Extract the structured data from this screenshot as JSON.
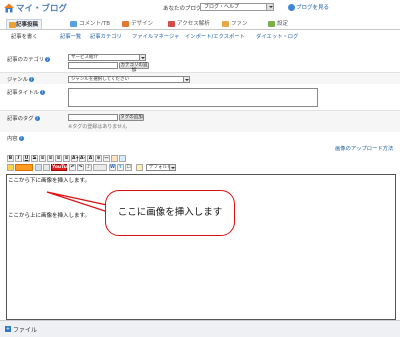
{
  "header": {
    "title": "マイ・ブログ",
    "my_blog_label": "あなたのブログ：",
    "blog_select_value": "ブログ・ヘルプ",
    "view_blog_link": "ブログを見る"
  },
  "tabs": [
    {
      "label": "記事投稿",
      "icon": "pen-icon",
      "color": "#f0a030"
    },
    {
      "label": "コメント/TB",
      "icon": "comment-icon",
      "color": "#5aa0e0"
    },
    {
      "label": "デザイン",
      "icon": "palette-icon",
      "color": "#e07a30"
    },
    {
      "label": "アクセス解析",
      "icon": "chart-icon",
      "color": "#d24b4b"
    },
    {
      "label": "ファン",
      "icon": "fan-icon",
      "color": "#e8a84a"
    },
    {
      "label": "設定",
      "icon": "gear-icon",
      "color": "#7ab04a"
    }
  ],
  "subtabs": [
    "記事を書く",
    "記事一覧",
    "記事カテゴリ",
    "ファイルマネージャ",
    "インポート/エクスポート",
    "ダイエット・ログ"
  ],
  "form": {
    "category_label": "記事のカテゴリ",
    "category_select_value": "サービス紹介",
    "category_add_button": "カテゴリの追加",
    "genre_label": "ジャンル",
    "genre_select_value": "ジャンルを選択してください",
    "title_label": "記事タイトル",
    "title_value": "",
    "tag_label": "記事のタグ",
    "tag_add_button": "タグの追加",
    "tag_note": "※タグの登録はありません",
    "content_label": "内容",
    "upload_link": "画像のアップロード方法"
  },
  "toolbar": {
    "row1": [
      "B",
      "I",
      "U",
      "S",
      "≡",
      "≡",
      "≡",
      "≡",
      "A+",
      "A-",
      "A",
      "⊕",
      "—"
    ],
    "row2_items": [
      "emoji",
      "blog",
      "mail",
      "YouTube",
      "↶",
      "↷",
      "♪",
      "MOVIE",
      "W",
      "t",
      "☐"
    ],
    "youtube_label": "YouTube",
    "font_select": "デフォルト"
  },
  "editor": {
    "line1": "ここから下に画像を挿入します。",
    "line2": "ここから上に画像を挿入します。"
  },
  "callout": {
    "text": "ここに画像を挿入します"
  },
  "file_section": {
    "label": "ファイル"
  }
}
